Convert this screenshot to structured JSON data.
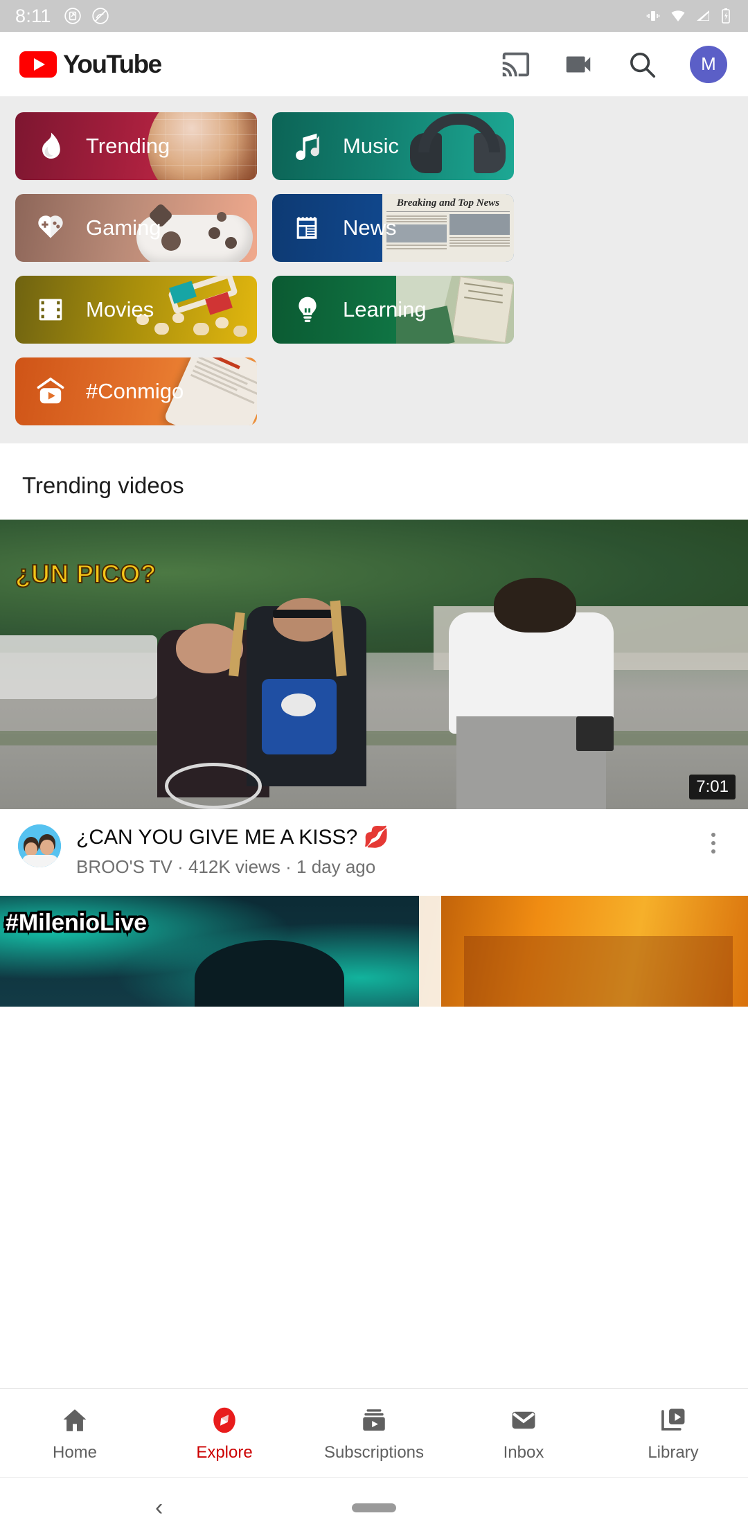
{
  "status_bar": {
    "time": "8:11",
    "left_icons": [
      "screenshot-icon",
      "no-sync-icon"
    ],
    "right_icons": [
      "vibrate-icon",
      "wifi-icon",
      "signal-icon",
      "battery-charging-icon"
    ]
  },
  "header": {
    "brand": "YouTube",
    "logo": "youtube-logo",
    "actions": [
      "cast-icon",
      "camera-icon",
      "search-icon"
    ],
    "avatar_initial": "M",
    "avatar_color": "#5b5fc7"
  },
  "categories": [
    {
      "label": "Trending",
      "icon": "flame-icon",
      "color_start": "#8c1f37",
      "color_end": "#d32a45",
      "art": "globe"
    },
    {
      "label": "Music",
      "icon": "music-note-icon",
      "color_start": "#0d6b5e",
      "color_end": "#1e9e88",
      "art": "headphones"
    },
    {
      "label": "Gaming",
      "icon": "gamepad-icon",
      "color_start": "#8a6356",
      "color_end": "#efa88c",
      "art": "controller"
    },
    {
      "label": "News",
      "icon": "newspaper-icon",
      "color_start": "#11407d",
      "color_end": "#1565c0",
      "art": "newspaper"
    },
    {
      "label": "Movies",
      "icon": "film-strip-icon",
      "color_start": "#7a6a10",
      "color_end": "#e0b510",
      "art": "popcorn"
    },
    {
      "label": "Learning",
      "icon": "lightbulb-icon",
      "color_start": "#0c5c33",
      "color_end": "#1f8a52",
      "art": "books"
    },
    {
      "label": "#Conmigo",
      "icon": "home-play-icon",
      "color_start": "#d1551a",
      "color_end": "#f5933c",
      "art": "phone"
    }
  ],
  "trending_section": {
    "heading": "Trending videos"
  },
  "videos": [
    {
      "title": "¿CAN YOU GIVE ME A KISS? 💋",
      "channel": "BROO'S TV",
      "views": "412K views",
      "age": "1 day ago",
      "meta_line": "BROO'S TV · 412K views · 1 day ago",
      "duration": "7:01",
      "thumbnail_text": "¿UN PICO?",
      "menu_icon": "more-vertical-icon"
    },
    {
      "thumbnail_text": "#MilenioLive"
    }
  ],
  "bottom_nav": {
    "active": "Explore",
    "items": [
      {
        "label": "Home",
        "icon": "home-icon"
      },
      {
        "label": "Explore",
        "icon": "compass-icon"
      },
      {
        "label": "Subscriptions",
        "icon": "subscriptions-icon"
      },
      {
        "label": "Inbox",
        "icon": "mail-icon"
      },
      {
        "label": "Library",
        "icon": "library-icon"
      }
    ],
    "active_color": "#cc0000"
  },
  "system_nav": {
    "back": "‹",
    "home_pill": "home-pill"
  }
}
